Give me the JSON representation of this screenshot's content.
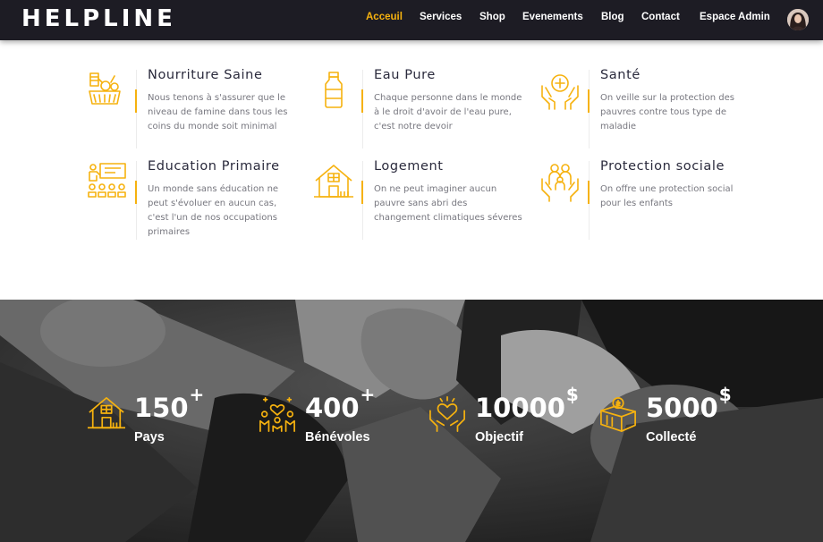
{
  "header": {
    "brand": "HELPLINE",
    "nav": [
      {
        "label": "Acceuil",
        "active": true
      },
      {
        "label": "Services",
        "active": false
      },
      {
        "label": "Shop",
        "active": false
      },
      {
        "label": "Evenements",
        "active": false
      },
      {
        "label": "Blog",
        "active": false
      },
      {
        "label": "Contact",
        "active": false
      },
      {
        "label": "Espace Admin",
        "active": false
      }
    ]
  },
  "services": [
    {
      "title": "Nourriture Saine",
      "desc": "Nous tenons à s'assurer que le niveau de famine dans tous les coins du monde soit minimal",
      "icon": "food-basket-icon"
    },
    {
      "title": "Eau Pure",
      "desc": "Chaque personne dans le monde à le droit d'avoir de l'eau pure, c'est notre devoir",
      "icon": "water-bottle-icon"
    },
    {
      "title": "Santé",
      "desc": "On veille sur la protection des pauvres contre tous type de maladie",
      "icon": "health-hands-icon"
    },
    {
      "title": "Education Primaire",
      "desc": "Un monde sans éducation ne peut s'évoluer en aucun cas, c'est l'un de nos occupations primaires",
      "icon": "classroom-icon"
    },
    {
      "title": "Logement",
      "desc": "On ne peut imaginer aucun pauvre sans abri des changement climatiques séveres",
      "icon": "house-icon"
    },
    {
      "title": "Protection sociale",
      "desc": "On offre une protection social pour les enfants",
      "icon": "family-hands-icon"
    }
  ],
  "stats": [
    {
      "value": "150",
      "suffix": "+",
      "label": "Pays",
      "icon": "house-icon"
    },
    {
      "value": "400",
      "suffix": "+",
      "label": "Bénévoles",
      "icon": "volunteers-icon"
    },
    {
      "value": "10000",
      "suffix": "$",
      "label": "Objectif",
      "icon": "heart-hands-icon"
    },
    {
      "value": "5000",
      "suffix": "$",
      "label": "Collecté",
      "icon": "donation-box-icon"
    }
  ],
  "colors": {
    "accent": "#f6b20f",
    "header_bg": "#1d1c24",
    "band_bg": "#545454"
  }
}
